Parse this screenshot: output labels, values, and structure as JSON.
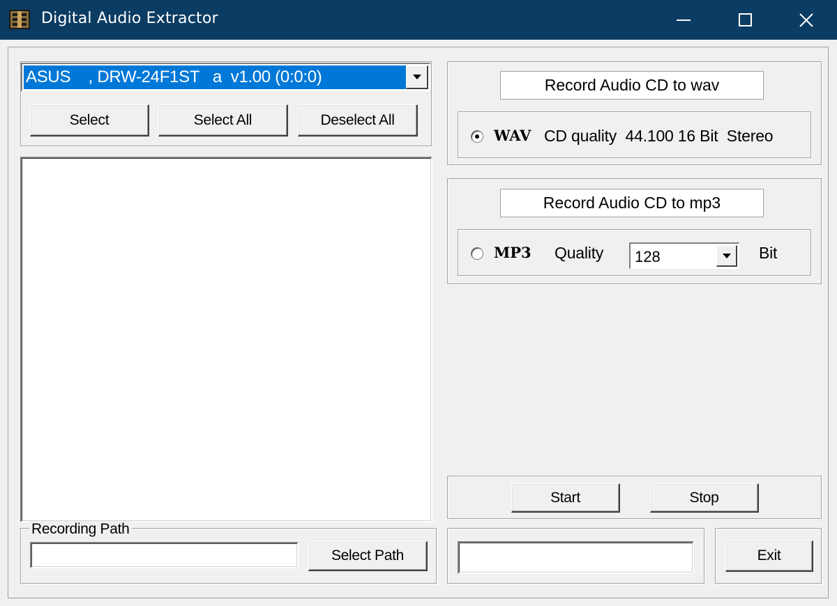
{
  "window": {
    "title": "Digital Audio Extractor",
    "icon": "film-reel-icon",
    "close_glyph": "✕"
  },
  "drive": {
    "selected": "ASUS    , DRW-24F1ST   a  v1.00 (0:0:0)"
  },
  "track_buttons": {
    "select": "Select",
    "select_all": "Select All",
    "deselect_all": "Deselect All"
  },
  "wav_section": {
    "heading": "Record Audio CD to wav",
    "radio_label": "WAV",
    "checked": true,
    "description": "CD quality  44.100 16 Bit  Stereo"
  },
  "mp3_section": {
    "heading": "Record Audio CD to mp3",
    "radio_label": "MP3",
    "checked": false,
    "quality_label": "Quality",
    "quality_value": "128",
    "unit": "Bit"
  },
  "recording_path": {
    "legend": "Recording Path",
    "value": "",
    "button": "Select Path"
  },
  "controls": {
    "start": "Start",
    "stop": "Stop",
    "exit": "Exit",
    "status": ""
  },
  "colors": {
    "titlebar": "#0b3c63",
    "selection": "#0078d7",
    "face": "#f0f0f0"
  }
}
